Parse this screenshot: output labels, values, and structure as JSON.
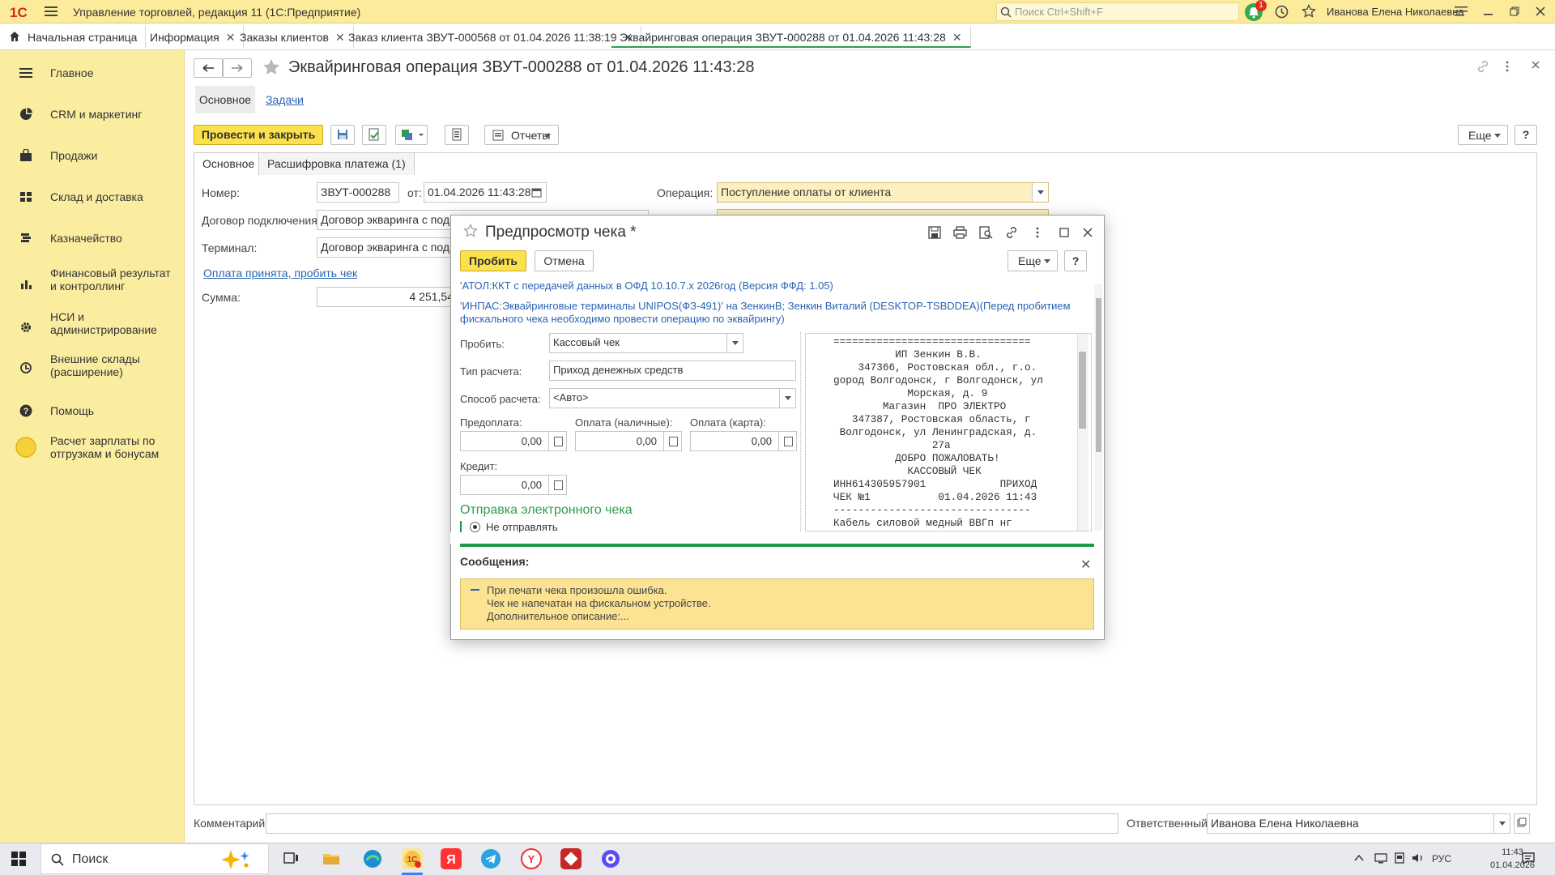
{
  "titlebar": {
    "logo": "1С",
    "app_title": "Управление торговлей, редакция 11 (1С:Предприятие)",
    "search_placeholder": "Поиск Ctrl+Shift+F",
    "notification_count": "1",
    "user": "Иванова Елена Николаевна"
  },
  "tabs": [
    {
      "label": "Начальная страница"
    },
    {
      "label": "Информация"
    },
    {
      "label": "Заказы клиентов"
    },
    {
      "label": "Заказ клиента ЗВУТ-000568 от 01.04.2026 11:38:19"
    },
    {
      "label": "Эквайринговая операция ЗВУТ-000288 от 01.04.2026 11:43:28"
    }
  ],
  "sidebar": [
    {
      "label": "Главное",
      "icon": "menu-icon"
    },
    {
      "label": "CRM и маркетинг",
      "icon": "pie-chart-icon"
    },
    {
      "label": "Продажи",
      "icon": "bag-icon"
    },
    {
      "label": "Склад и доставка",
      "icon": "warehouse-icon"
    },
    {
      "label": "Казначейство",
      "icon": "coins-icon"
    },
    {
      "label": "Финансовый результат и контроллинг",
      "icon": "bar-chart-icon"
    },
    {
      "label": "НСИ и администрирование",
      "icon": "gear-icon"
    },
    {
      "label": "Внешние склады (расширение)",
      "icon": "external-warehouse-icon"
    },
    {
      "label": "Помощь",
      "icon": "help-icon"
    },
    {
      "label": "Расчет зарплаты по отгрузкам и бонусам",
      "icon": "circle-icon"
    }
  ],
  "document": {
    "title": "Эквайринговая операция ЗВУТ-000288 от 01.04.2026 11:43:28",
    "subtabs": {
      "main": "Основное",
      "tasks": "Задачи"
    },
    "toolbar": {
      "post_close": "Провести и закрыть",
      "reports": "Отчеты",
      "more": "Еще",
      "help": "?"
    },
    "form_tabs": {
      "main": "Основное",
      "breakdown": "Расшифровка платежа (1)"
    },
    "labels": {
      "number": "Номер:",
      "from": "от:",
      "operation": "Операция:",
      "contract": "Договор подключения:",
      "terminal": "Терминал:",
      "sum": "Сумма:",
      "comment": "Комментарий:",
      "responsible": "Ответственный:"
    },
    "values": {
      "number": "ЗВУТ-000288",
      "date": "01.04.2026 11:43:28",
      "operation": "Поступление оплаты от клиента",
      "contract": "Договор экваринга с подк",
      "terminal": "Договор экваринга с подк",
      "sum": "4 251,54",
      "comment": "",
      "responsible": "Иванова Елена Николаевна"
    },
    "payment_link": "Оплата принята, пробить чек"
  },
  "dialog": {
    "title": "Предпросмотр чека *",
    "print": "Пробить",
    "cancel": "Отмена",
    "more": "Еще",
    "help": "?",
    "device_line1": "'АТОЛ:ККТ с передачей данных в ОФД 10.10.7.x 2026год (Версия ФФД: 1.05)",
    "device_line2": "'ИНПАС:Эквайринговые терминалы UNIPOS(ФЗ-491)' на ЗенкинВ; Зенкин Виталий (DESKTOP-TSBDDEA)(Перед пробитием фискального чека необходимо провести операцию по эквайрингу)",
    "labels": {
      "print_type": "Пробить:",
      "calc_type": "Тип расчета:",
      "calc_method": "Способ расчета:",
      "prepay": "Предоплата:",
      "cash": "Оплата (наличные):",
      "card": "Оплата (карта):",
      "credit": "Кредит:"
    },
    "values": {
      "print_type": "Кассовый чек",
      "calc_type": "Приход денежных средств",
      "calc_method": "<Авто>",
      "prepay": "0,00",
      "cash": "0,00",
      "card": "0,00",
      "credit": "0,00"
    },
    "send_header": "Отправка электронного чека",
    "send_option": "Не отправлять",
    "receipt_text": "================================\n          ИП Зенкин В.В.\n    347366, Ростовская обл., г.о.\ngород Волгодонск, г Волгодонск, ул\n            Морская, д. 9\n        Магазин  ПРО ЭЛЕКТРО\n   347387, Ростовская область, г\n Волгодонск, ул Ленинградская, д.\n                27а\n          ДОБРО ПОЖАЛОВАТЬ!\n            КАССОВЫЙ ЧЕК\nИНН614305957901            ПРИХОД\nЧЕК №1           01.04.2026 11:43\n--------------------------------\nКабель силовой медный ВВГп нг",
    "messages_header": "Сообщения:",
    "message": "При печати чека произошла ошибка.\nЧек не напечатан на фискальном устройстве.\nДополнительное описание:..."
  },
  "taskbar": {
    "search": "Поиск",
    "lang": "РУС",
    "time": "11:43",
    "date": "01.04.2026"
  },
  "colors": {
    "accent": "#fbe14b",
    "sidebar": "#fbeda0",
    "green": "#1e9a46",
    "link": "#2a64b5"
  }
}
